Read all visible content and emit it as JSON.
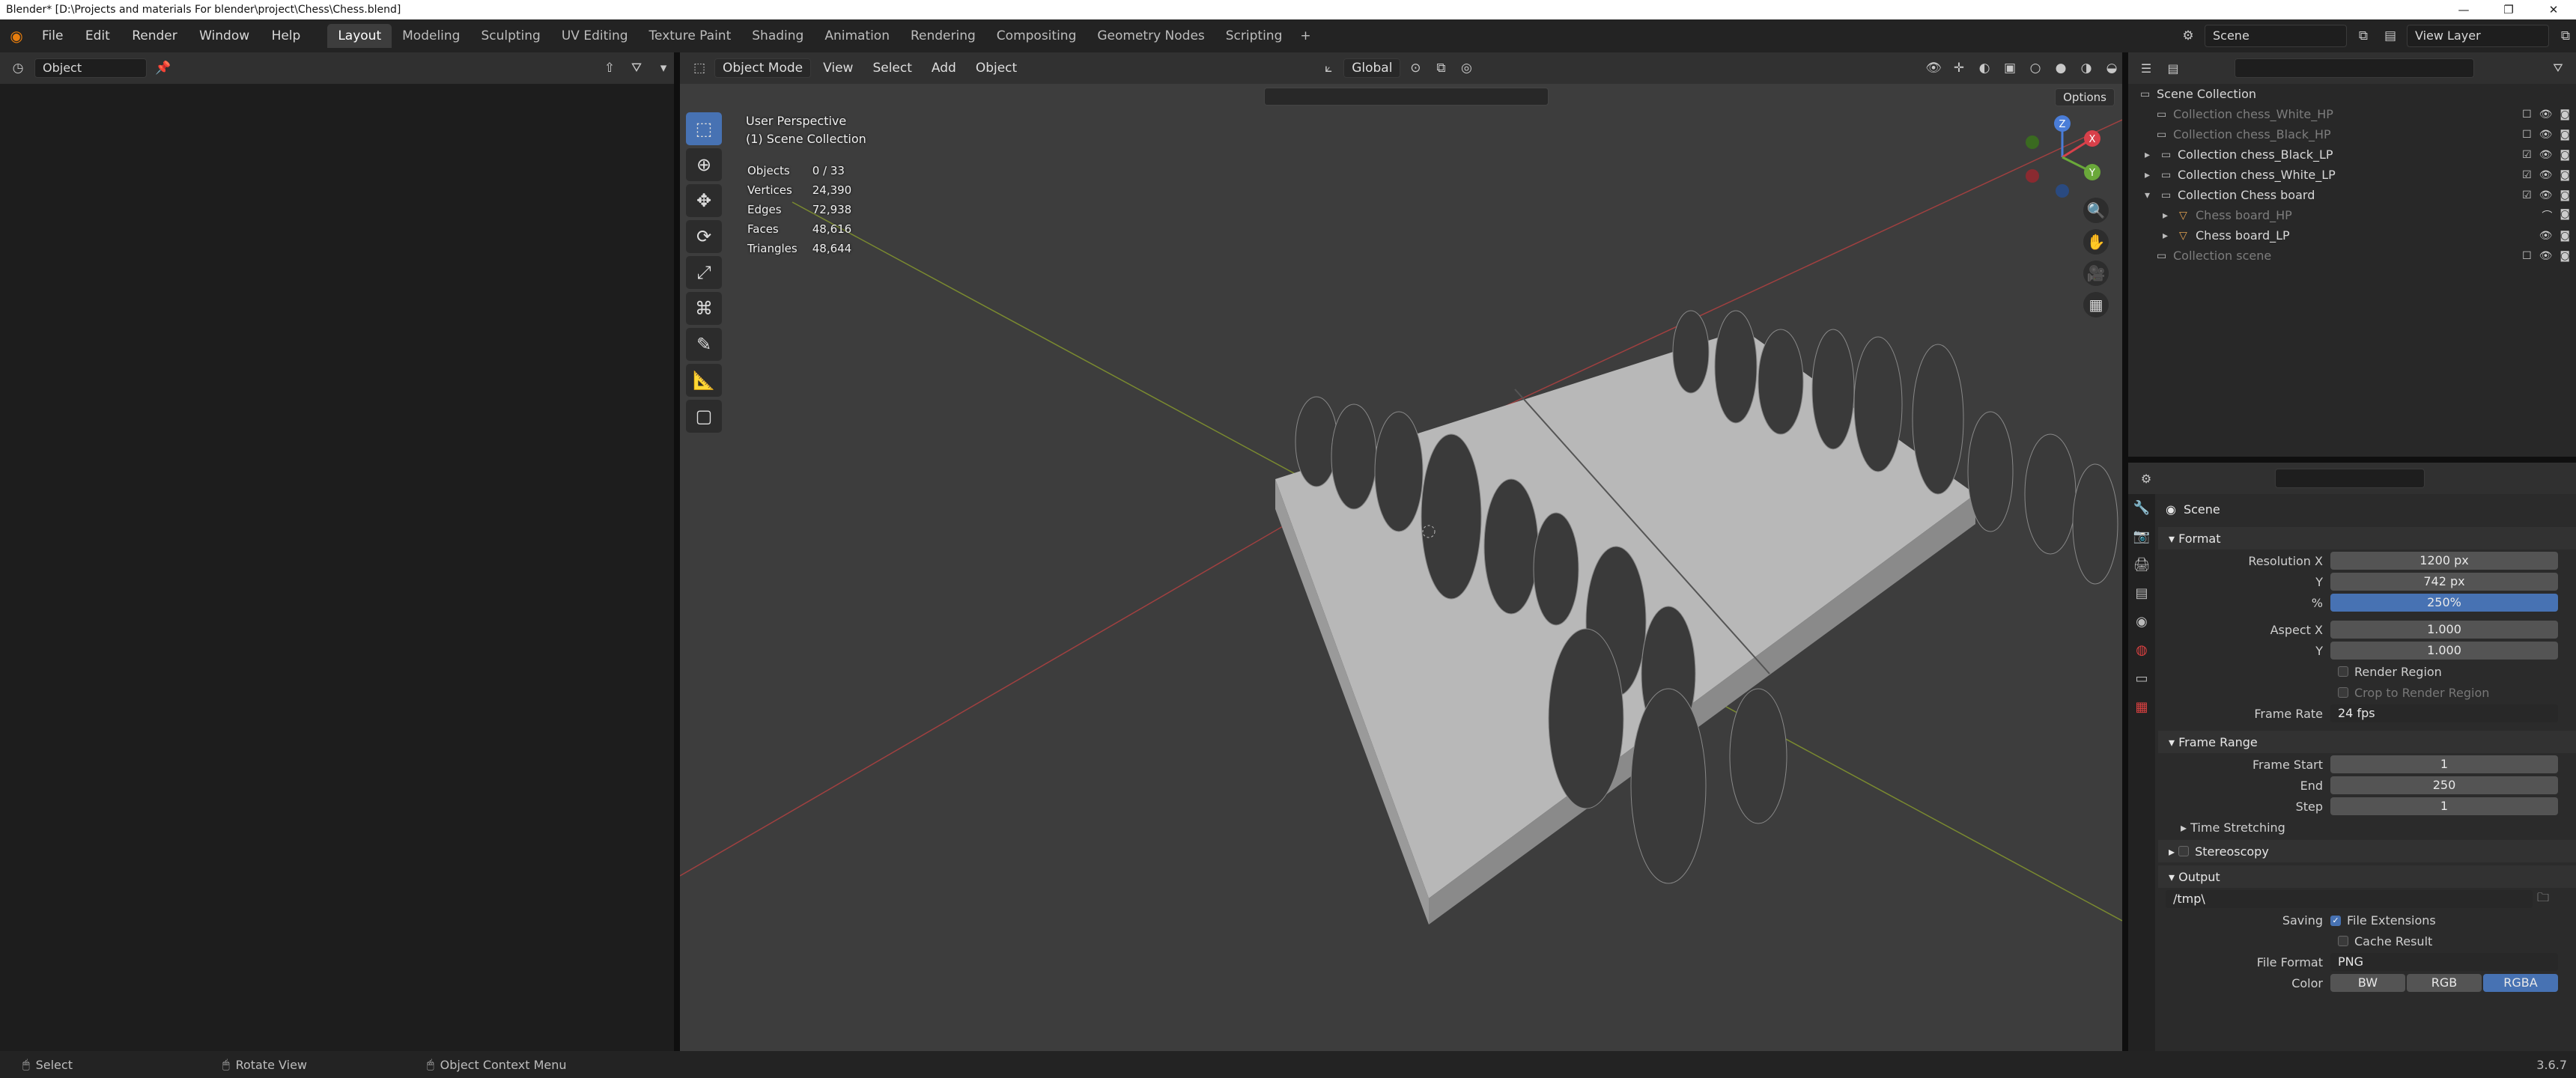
{
  "titlebar": {
    "title": "Blender* [D:\\Projects and materials For blender\\project\\Chess\\Chess.blend]"
  },
  "menu": {
    "file": "File",
    "edit": "Edit",
    "render": "Render",
    "window": "Window",
    "help": "Help"
  },
  "workspaces": [
    "Layout",
    "Modeling",
    "Sculpting",
    "UV Editing",
    "Texture Paint",
    "Shading",
    "Animation",
    "Rendering",
    "Compositing",
    "Geometry Nodes",
    "Scripting"
  ],
  "scene": {
    "name": "Scene",
    "view_layer": "View Layer"
  },
  "left_editor": {
    "mode": "Object"
  },
  "viewport": {
    "mode": "Object Mode",
    "menus": [
      "View",
      "Select",
      "Add",
      "Object"
    ],
    "orientation": "Global",
    "options": "Options",
    "perspective": "User Perspective",
    "collection": "(1) Scene Collection",
    "stats": [
      [
        "Objects",
        "0 / 33"
      ],
      [
        "Vertices",
        "24,390"
      ],
      [
        "Edges",
        "72,938"
      ],
      [
        "Faces",
        "48,616"
      ],
      [
        "Triangles",
        "48,644"
      ]
    ]
  },
  "outliner": {
    "root": "Scene Collection",
    "rows": [
      {
        "label": "Collection chess_White_HP",
        "dim": true
      },
      {
        "label": "Collection chess_Black_HP",
        "dim": true
      },
      {
        "label": "Collection chess_Black_LP",
        "dim": false
      },
      {
        "label": "Collection chess_White_LP",
        "dim": false
      },
      {
        "label": "Collection Chess board",
        "dim": false
      },
      {
        "label": "Chess board_HP",
        "dim": true
      },
      {
        "label": "Chess board_LP",
        "dim": false
      },
      {
        "label": "Collection scene",
        "dim": true
      }
    ]
  },
  "properties": {
    "scene_title": "Scene",
    "format": {
      "header": "Format",
      "res_x_label": "Resolution X",
      "res_x": "1200 px",
      "res_y_label": "Y",
      "res_y": "742 px",
      "pct_label": "%",
      "pct": "250%",
      "aspect_x_label": "Aspect X",
      "aspect_x": "1.000",
      "aspect_y_label": "Y",
      "aspect_y": "1.000",
      "render_region": "Render Region",
      "crop": "Crop to Render Region",
      "frame_rate_label": "Frame Rate",
      "frame_rate": "24 fps"
    },
    "frame_range": {
      "header": "Frame Range",
      "start_label": "Frame Start",
      "start": "1",
      "end_label": "End",
      "end": "250",
      "step_label": "Step",
      "step": "1"
    },
    "time_stretching": "Time Stretching",
    "stereoscopy": "Stereoscopy",
    "output": {
      "header": "Output",
      "path": "/tmp\\",
      "saving_label": "Saving",
      "file_ext": "File Extensions",
      "cache": "Cache Result",
      "format_label": "File Format",
      "format": "PNG",
      "color_label": "Color",
      "color_opts": [
        "BW",
        "RGB",
        "RGBA"
      ],
      "color_selected": "RGBA"
    }
  },
  "status": {
    "select": "Select",
    "rotate": "Rotate View",
    "context": "Object Context Menu",
    "version": "3.6.7"
  }
}
